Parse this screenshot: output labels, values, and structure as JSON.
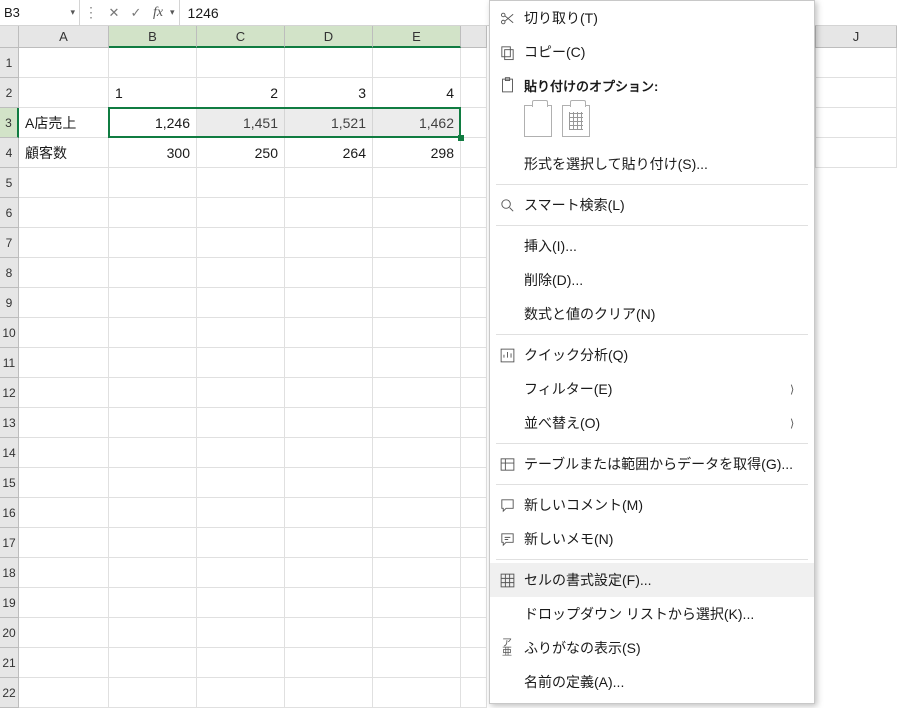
{
  "formula_bar": {
    "cell_ref": "B3",
    "dropdown_glyph": "▾",
    "cancel_glyph": "✕",
    "confirm_glyph": "✓",
    "fx_label": "fx",
    "fx_dd": "▾",
    "value": "1246"
  },
  "columns": [
    "A",
    "B",
    "C",
    "D",
    "E",
    "J"
  ],
  "selected_cols": [
    "B",
    "C",
    "D",
    "E"
  ],
  "row_headers": [
    "1",
    "2",
    "3",
    "4",
    "5",
    "6",
    "7",
    "8",
    "9",
    "10",
    "11",
    "12",
    "13",
    "14",
    "15",
    "16",
    "17",
    "18",
    "19",
    "20",
    "21",
    "22"
  ],
  "selected_row": "3",
  "cells": {
    "r2": {
      "B": "1",
      "C": "2",
      "D": "3",
      "E": "4"
    },
    "r3": {
      "A": "A店売上",
      "B": "1,246",
      "C": "1,451",
      "D": "1,521",
      "E": "1,462"
    },
    "r4": {
      "A": "顧客数",
      "B": "300",
      "C": "250",
      "D": "264",
      "E": "298"
    }
  },
  "menu": {
    "cut": "切り取り(T)",
    "copy": "コピー(C)",
    "paste_header": "貼り付けのオプション:",
    "paste_special": "形式を選択して貼り付け(S)...",
    "smart_lookup": "スマート検索(L)",
    "insert": "挿入(I)...",
    "delete": "削除(D)...",
    "clear": "数式と値のクリア(N)",
    "quick_analysis": "クイック分析(Q)",
    "filter": "フィルター(E)",
    "sort": "並べ替え(O)",
    "get_data": "テーブルまたは範囲からデータを取得(G)...",
    "new_comment": "新しいコメント(M)",
    "new_note": "新しいメモ(N)",
    "format_cells": "セルの書式設定(F)...",
    "dropdown_list": "ドロップダウン リストから選択(K)...",
    "phonetic": "ふりがなの表示(S)",
    "define_name": "名前の定義(A)...",
    "arrow": "⟩"
  },
  "chart_data": {
    "type": "table",
    "title": "",
    "columns": [
      "",
      "1",
      "2",
      "3",
      "4"
    ],
    "rows": [
      {
        "label": "A店売上",
        "values": [
          1246,
          1451,
          1521,
          1462
        ]
      },
      {
        "label": "顧客数",
        "values": [
          300,
          250,
          264,
          298
        ]
      }
    ]
  }
}
